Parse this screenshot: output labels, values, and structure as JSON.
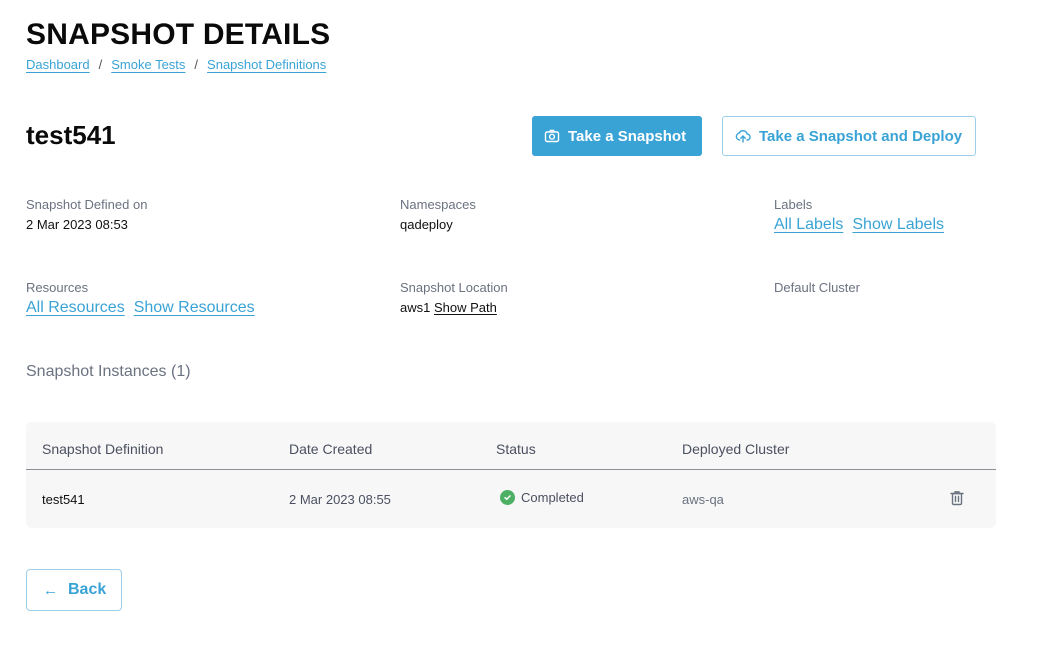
{
  "header": {
    "title": "SNAPSHOT DETAILS",
    "breadcrumb": [
      {
        "label": "Dashboard"
      },
      {
        "label": "Smoke Tests"
      },
      {
        "label": "Snapshot Definitions"
      }
    ],
    "separator": "/"
  },
  "snapshot": {
    "name": "test541",
    "actions": {
      "take_snapshot": {
        "label": "Take a Snapshot",
        "icon": "camera-icon"
      },
      "take_snapshot_deploy": {
        "label": "Take a Snapshot and Deploy",
        "icon": "cloud-upload-icon"
      }
    }
  },
  "details": {
    "defined_on": {
      "label": "Snapshot Defined on",
      "value": "2 Mar 2023 08:53"
    },
    "namespaces": {
      "label": "Namespaces",
      "value": "qadeploy"
    },
    "labels": {
      "label": "Labels",
      "link_all": "All Labels",
      "link_show": "Show Labels"
    },
    "resources": {
      "label": "Resources",
      "link_all": "All Resources",
      "link_show": "Show Resources"
    },
    "location": {
      "label": "Snapshot Location",
      "value": "aws1",
      "link": "Show Path"
    },
    "default_cluster": {
      "label": "Default Cluster",
      "value": ""
    }
  },
  "instances": {
    "title": "Snapshot Instances (1)",
    "columns": [
      "Snapshot Definition",
      "Date Created",
      "Status",
      "Deployed Cluster"
    ],
    "rows": [
      {
        "definition": "test541",
        "date_created": "2 Mar 2023 08:55",
        "status": "Completed",
        "status_color": "#4caf63",
        "cluster": "aws-qa"
      }
    ]
  },
  "footer": {
    "back_label": "Back",
    "back_arrow": "←"
  },
  "colors": {
    "accent": "#3aa3d6",
    "success": "#4caf63"
  }
}
